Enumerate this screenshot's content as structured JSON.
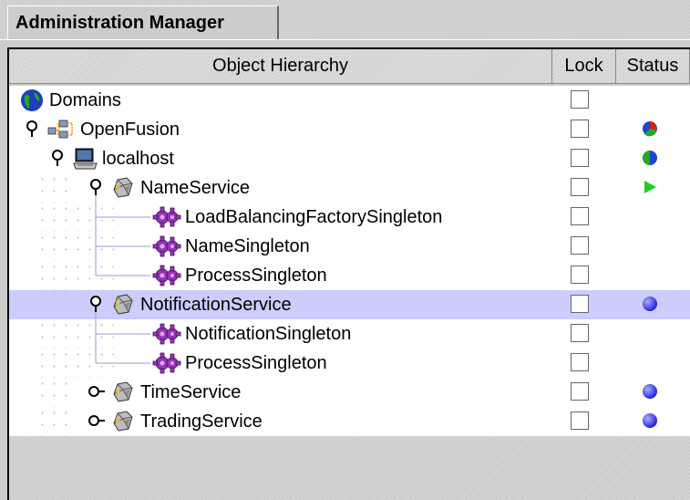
{
  "tabs": {
    "active_label": "Administration Manager"
  },
  "table": {
    "columns": {
      "hierarchy": "Object Hierarchy",
      "lock": "Lock",
      "status": "Status"
    }
  },
  "tree": {
    "rows": [
      {
        "label": "Domains",
        "icon": "globe-icon",
        "depth": 0,
        "expander": "none",
        "locked": false,
        "status": "none"
      },
      {
        "label": "OpenFusion",
        "icon": "network-icon",
        "depth": 0,
        "expander": "expanded",
        "locked": false,
        "status": "multicolor-ball"
      },
      {
        "label": "localhost",
        "icon": "computer-icon",
        "depth": 1,
        "expander": "expanded",
        "locked": false,
        "status": "green-blue-ball"
      },
      {
        "label": "NameService",
        "icon": "service-icon",
        "depth": 2,
        "expander": "expanded",
        "locked": false,
        "status": "green-play"
      },
      {
        "label": "LoadBalancingFactorySingleton",
        "icon": "singleton-gear-icon",
        "depth": 3,
        "expander": "none",
        "locked": false,
        "status": "none"
      },
      {
        "label": "NameSingleton",
        "icon": "singleton-gear-icon",
        "depth": 3,
        "expander": "none",
        "locked": false,
        "status": "none"
      },
      {
        "label": "ProcessSingleton",
        "icon": "singleton-gear-icon",
        "depth": 3,
        "expander": "none",
        "locked": false,
        "status": "none"
      },
      {
        "label": "NotificationService",
        "icon": "service-icon",
        "depth": 2,
        "expander": "expanded",
        "locked": false,
        "status": "blue-ball",
        "selected": true
      },
      {
        "label": "NotificationSingleton",
        "icon": "singleton-gear-icon",
        "depth": 3,
        "expander": "none",
        "locked": false,
        "status": "none"
      },
      {
        "label": "ProcessSingleton",
        "icon": "singleton-gear-icon",
        "depth": 3,
        "expander": "none",
        "locked": false,
        "status": "none"
      },
      {
        "label": "TimeService",
        "icon": "service-icon",
        "depth": 2,
        "expander": "collapsed",
        "locked": false,
        "status": "blue-ball"
      },
      {
        "label": "TradingService",
        "icon": "service-icon",
        "depth": 2,
        "expander": "collapsed",
        "locked": false,
        "status": "blue-ball"
      }
    ]
  },
  "colors": {
    "selection": "#ccccff",
    "tree_line": "#9999cc",
    "blue_ball": "#2222dd",
    "green_play": "#22cc22"
  }
}
